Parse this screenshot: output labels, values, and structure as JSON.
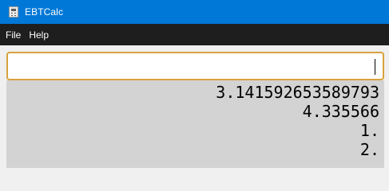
{
  "window": {
    "title": "EBTCalc",
    "icon": "calculator-icon"
  },
  "menu": {
    "items": [
      "File",
      "Help"
    ]
  },
  "input": {
    "value": "",
    "placeholder": ""
  },
  "results": {
    "lines": [
      "3.141592653589793",
      "4.335566",
      "1.",
      "2."
    ]
  },
  "colors": {
    "titlebar": "#0078d7",
    "menubar": "#1e1e1e",
    "input_border": "#d8a23c",
    "results_background": "#d3d3d3"
  }
}
